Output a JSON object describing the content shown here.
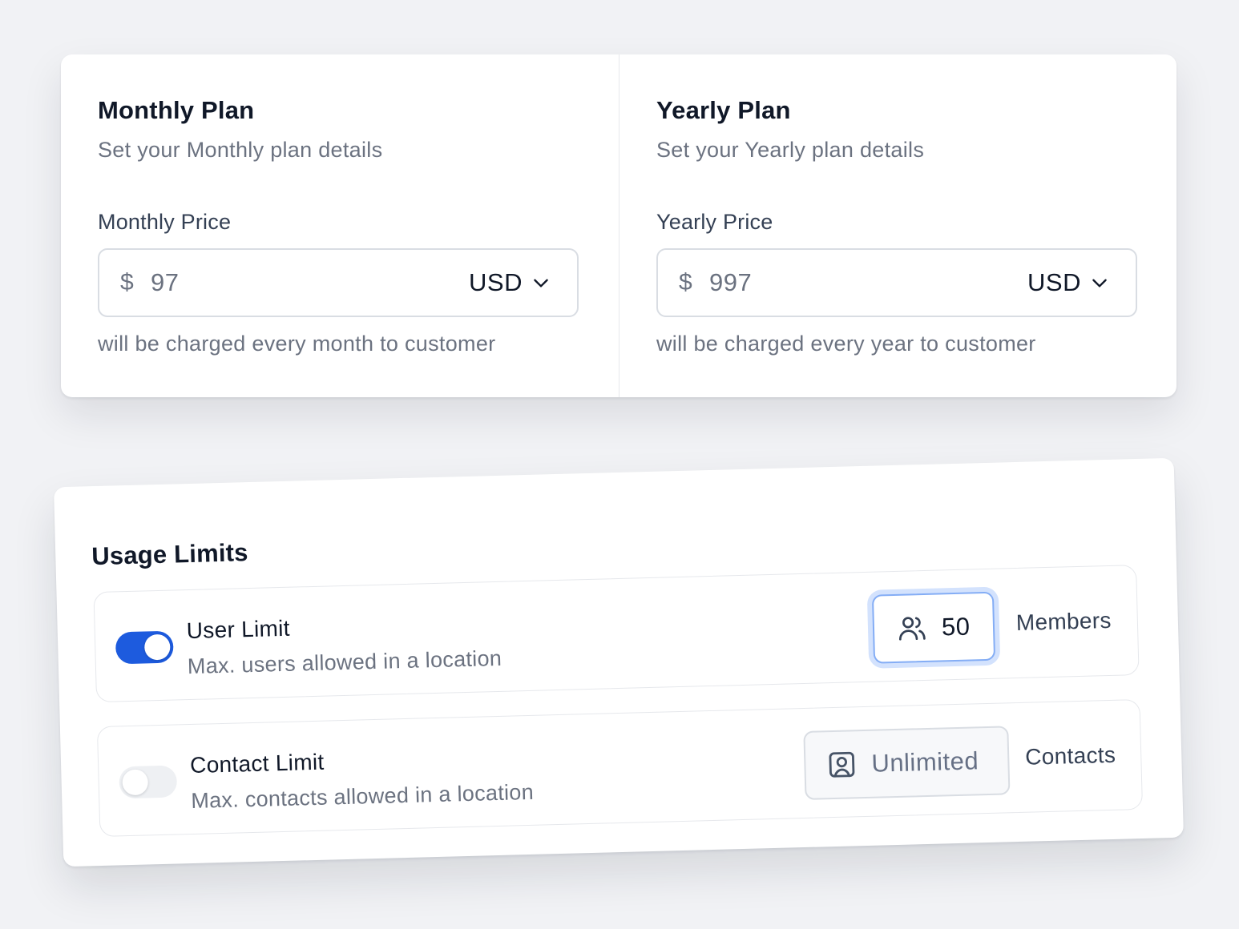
{
  "plans": [
    {
      "title": "Monthly Plan",
      "subtitle": "Set your Monthly plan details",
      "price_label": "Monthly Price",
      "currency_symbol": "$",
      "price_value": "97",
      "currency": "USD",
      "hint": "will be charged every month to customer"
    },
    {
      "title": "Yearly Plan",
      "subtitle": "Set your Yearly plan details",
      "price_label": "Yearly Price",
      "currency_symbol": "$",
      "price_value": "997",
      "currency": "USD",
      "hint": "will be charged every year to customer"
    }
  ],
  "usage": {
    "title": "Usage Limits",
    "limits": [
      {
        "name": "User Limit",
        "description": "Max. users allowed in a location",
        "enabled": true,
        "value": "50",
        "unit": "Members",
        "icon": "users-icon"
      },
      {
        "name": "Contact Limit",
        "description": "Max. contacts allowed in a location",
        "enabled": false,
        "value": "Unlimited",
        "unit": "Contacts",
        "icon": "contact-card-icon"
      }
    ]
  },
  "colors": {
    "accent": "#1d5bde",
    "focus_ring": "#d3e2fd",
    "text_primary": "#101828",
    "text_muted": "#6b7280",
    "border": "#d9dde3",
    "background": "#f1f2f5"
  }
}
